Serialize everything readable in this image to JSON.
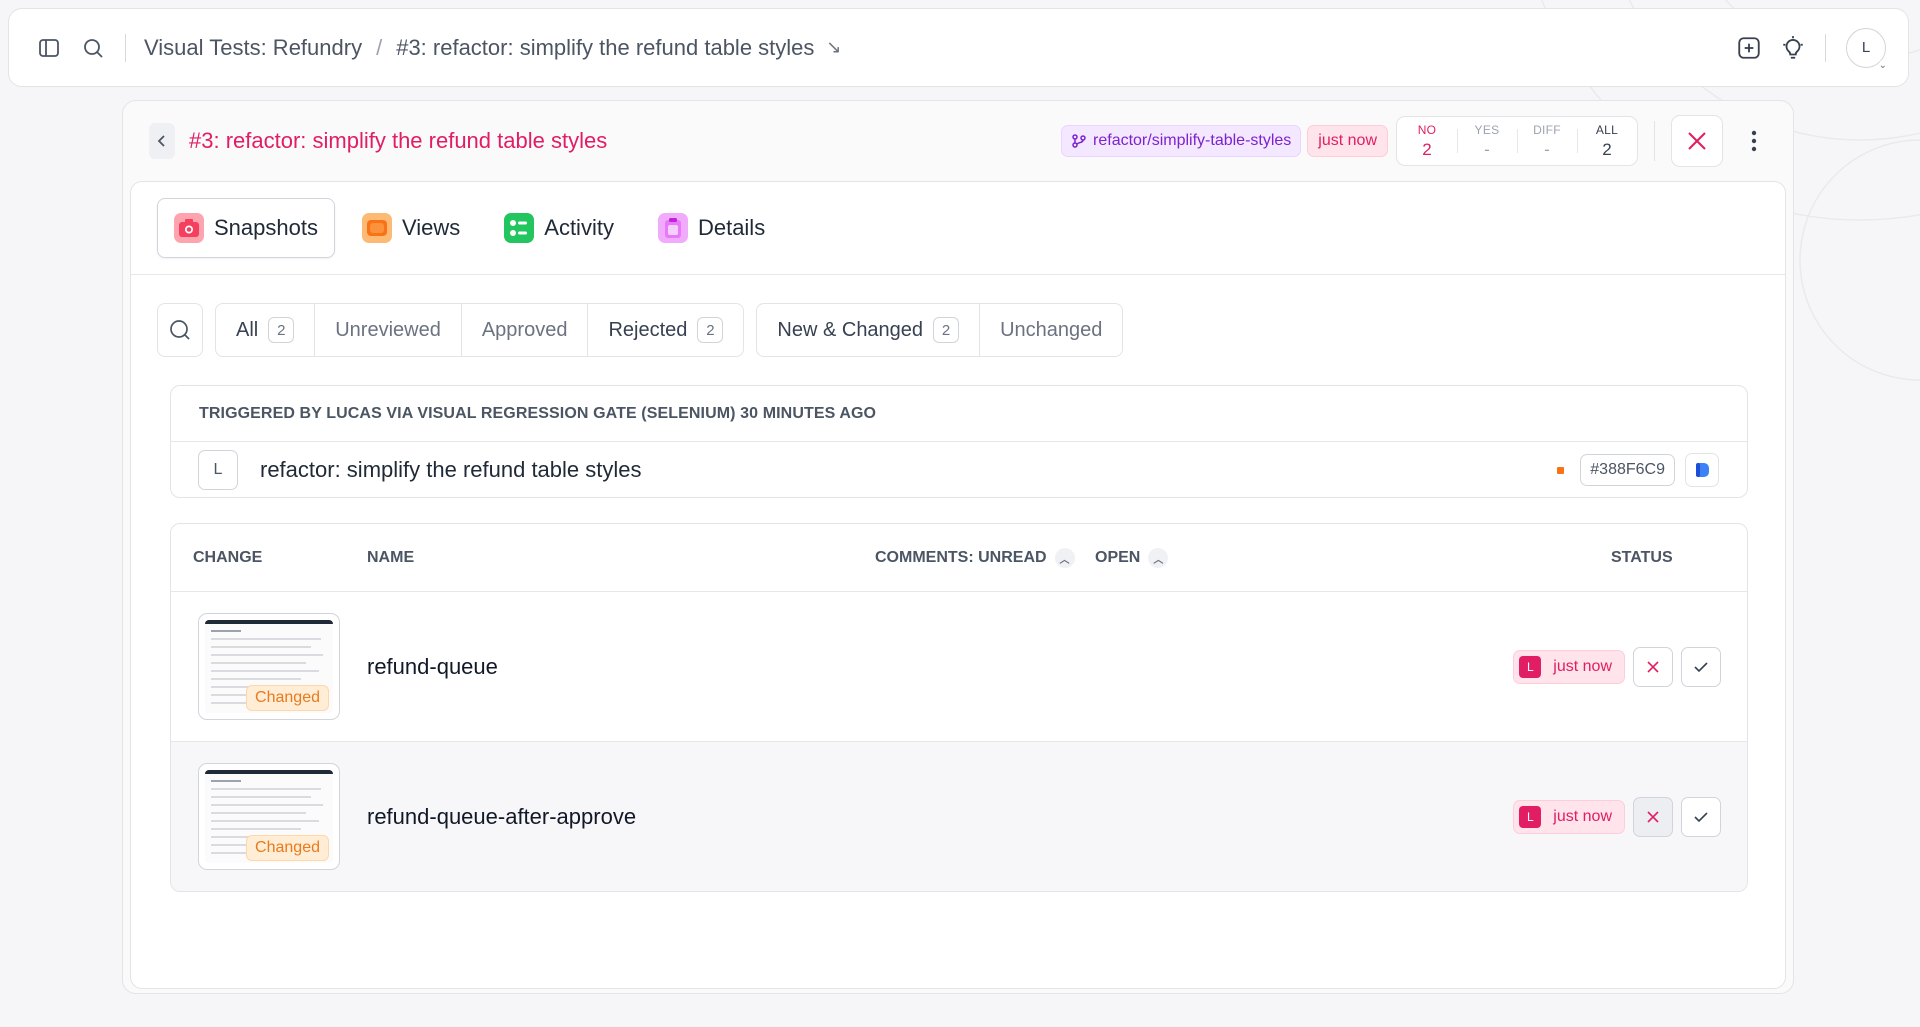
{
  "topbar": {
    "breadcrumb_project": "Visual Tests: Refundry",
    "breadcrumb_sep": "/",
    "breadcrumb_build": "#3: refactor: simplify the refund table styles",
    "breadcrumb_arrow": "↘",
    "avatar_letter": "L"
  },
  "build": {
    "title": "#3: refactor: simplify the refund table styles",
    "branch": "refactor/simplify-table-styles",
    "time": "just now",
    "counts": [
      {
        "label": "NO",
        "value": "2"
      },
      {
        "label": "YES",
        "value": "-"
      },
      {
        "label": "DIFF",
        "value": "-"
      },
      {
        "label": "ALL",
        "value": "2"
      }
    ]
  },
  "tabs": [
    {
      "label": "Snapshots",
      "icon": "camera-icon",
      "color": "#f43f5e"
    },
    {
      "label": "Views",
      "icon": "layers-icon",
      "color": "#f97316"
    },
    {
      "label": "Activity",
      "icon": "timeline-icon",
      "color": "#22c55e"
    },
    {
      "label": "Details",
      "icon": "clipboard-icon",
      "color": "#d946ef"
    }
  ],
  "filters": {
    "review": [
      {
        "label": "All",
        "count": "2"
      },
      {
        "label": "Unreviewed",
        "count": ""
      },
      {
        "label": "Approved",
        "count": ""
      },
      {
        "label": "Rejected",
        "count": "2"
      }
    ],
    "change": [
      {
        "label": "New & Changed",
        "count": "2"
      },
      {
        "label": "Unchanged",
        "count": ""
      }
    ]
  },
  "trigger": {
    "header": "TRIGGERED BY LUCAS VIA VISUAL REGRESSION GATE (SELENIUM) 30 MINUTES AGO",
    "author_letter": "L",
    "commit_message": "refactor: simplify the refund table styles",
    "sha": "#388F6C9"
  },
  "table": {
    "columns": {
      "change": "CHANGE",
      "name": "NAME",
      "comments_unread": "COMMENTS: UNREAD",
      "open": "OPEN",
      "status": "STATUS"
    },
    "rows": [
      {
        "name": "refund-queue",
        "change": "Changed",
        "status_letter": "L",
        "status_time": "just now"
      },
      {
        "name": "refund-queue-after-approve",
        "change": "Changed",
        "status_letter": "L",
        "status_time": "just now"
      }
    ]
  },
  "colors": {
    "accent": "#e11d63",
    "branch": "#7e22ce",
    "changed": "#ea7a1c"
  }
}
